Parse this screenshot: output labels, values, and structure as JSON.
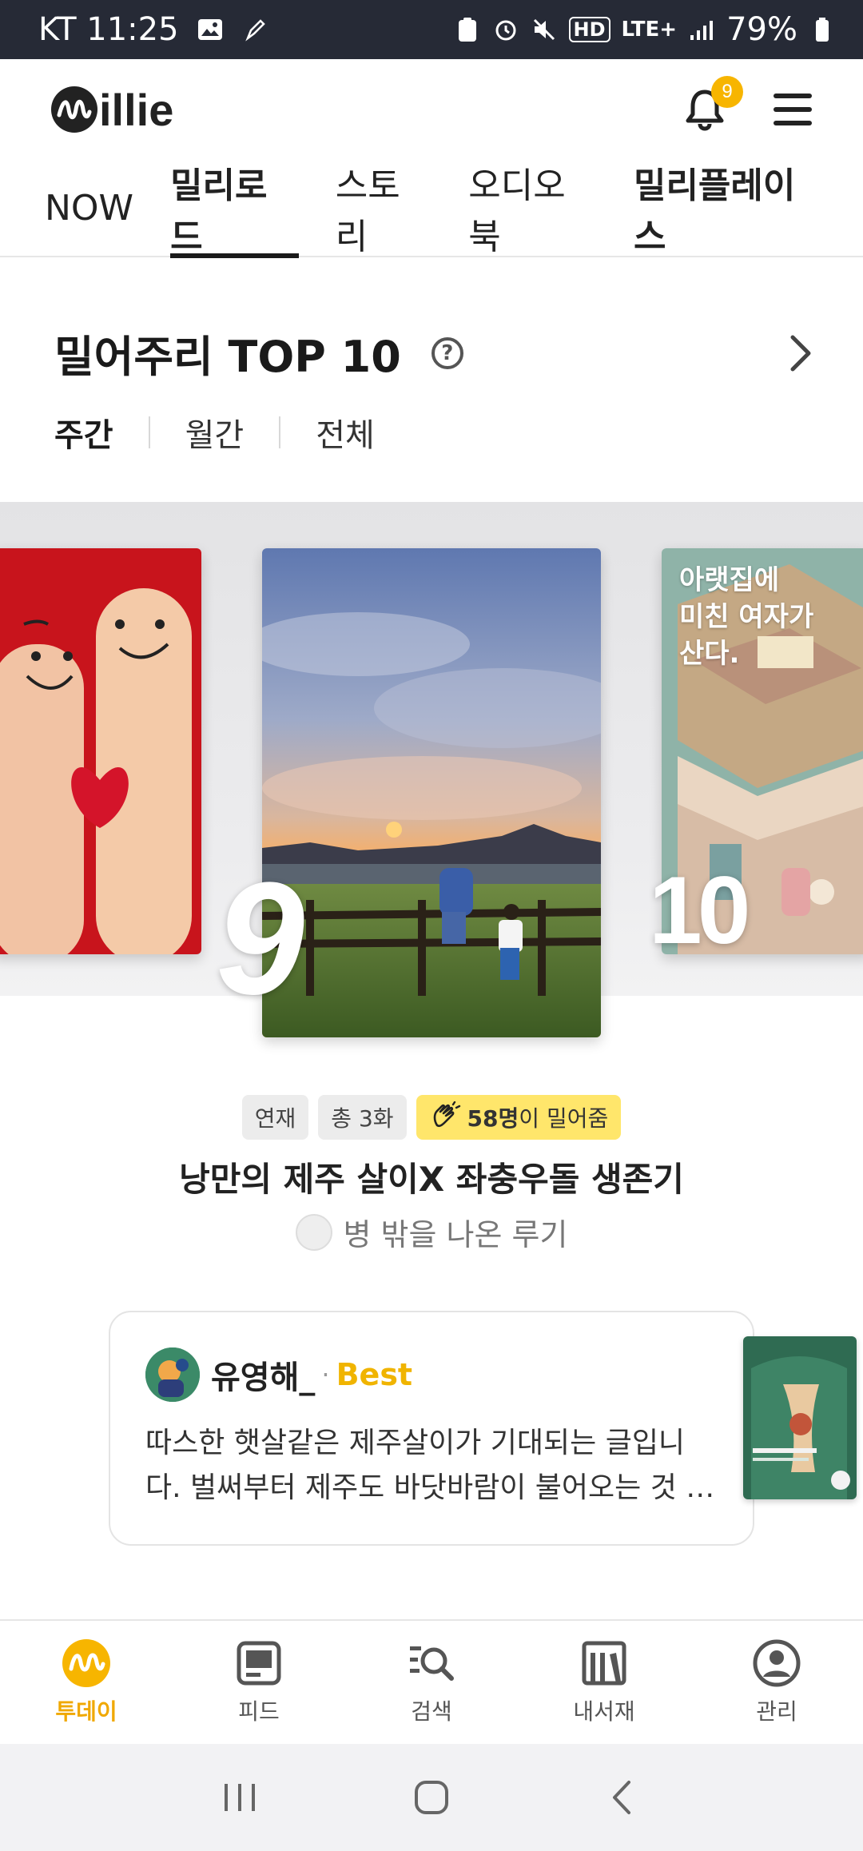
{
  "status_bar": {
    "carrier_time": "KT 11:25",
    "network": "LTE+",
    "hd": "HD",
    "battery": "79%"
  },
  "header": {
    "logo_text": "illie",
    "notification_count": "9"
  },
  "tabs": [
    {
      "label": "NOW"
    },
    {
      "label": "밀리로드"
    },
    {
      "label": "스토리"
    },
    {
      "label": "오디오북"
    },
    {
      "label": "밀리플레이스"
    }
  ],
  "section": {
    "title": "밀어주리 TOP 10",
    "help_glyph": "?",
    "periods": [
      "주간",
      "월간",
      "전체"
    ]
  },
  "carousel": {
    "rank_center": "9",
    "rank_right": "10",
    "right_cover_text": "아랫집에\n미친 여자가\n산다."
  },
  "book": {
    "tag_serial": "연재",
    "tag_episodes": "총 3화",
    "push_count": "58명",
    "push_suffix": "이 밀어줌",
    "title": "낭만의 제주 살이X 좌충우돌 생존기",
    "author": "병 밖을 나온 루기"
  },
  "review": {
    "name": "유영해_",
    "dot": "·",
    "badge": "Best",
    "line1": "따스한 햇살같은 제주살이가 기대되는 글입니",
    "line2": "다. 벌써부터 제주도 바닷바람이 불어오는 것 …"
  },
  "bottom_nav": [
    {
      "label": "투데이",
      "icon": "today-icon"
    },
    {
      "label": "피드",
      "icon": "feed-icon"
    },
    {
      "label": "검색",
      "icon": "search-icon"
    },
    {
      "label": "내서재",
      "icon": "library-icon"
    },
    {
      "label": "관리",
      "icon": "profile-icon"
    }
  ],
  "colors": {
    "accent": "#F0A800",
    "badge": "#F7B500",
    "status_bar": "#262A36",
    "push_tag": "#FFE66B"
  }
}
